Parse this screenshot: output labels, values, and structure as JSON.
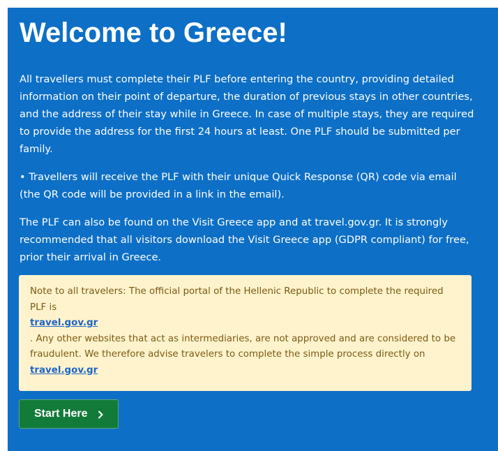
{
  "page": {
    "title": "Welcome to Greece!"
  },
  "content": {
    "paragraph1": "All travellers must complete their PLF before entering the country, providing detailed information on their point of departure, the duration of previous stays in other countries, and the address of their stay while in Greece. In case of multiple stays, they are required to provide the address for the first 24 hours at least. One PLF should be submitted per family.",
    "paragraph2": "• Travellers will receive the PLF with their unique Quick Response (QR) code via email (the QR code will be provided in a link in the email).",
    "paragraph3": "The PLF can also be found on the Visit Greece app and at travel.gov.gr. It is strongly recommended that all visitors download the Visit Greece app (GDPR compliant) for free, prior their arrival in Greece."
  },
  "notice": {
    "text_before_link": "Note to all travelers: The official portal of the Hellenic Republic to complete the required PLF is",
    "link1_text": "travel.gov.gr",
    "text_after_link": ". Any other websites that act as intermediaries, are not approved and are considered to be fraudulent. We therefore advise travelers to complete the simple process directly on",
    "link2_text": "travel.gov.gr"
  },
  "actions": {
    "start_label": "Start Here",
    "start_icon": "chevron-right-icon"
  },
  "colors": {
    "panel_background": "#0d6fc6",
    "notice_background": "#fff3cd",
    "notice_text": "#7a5a12",
    "link": "#1f65c6",
    "button_background": "#127b3a"
  }
}
